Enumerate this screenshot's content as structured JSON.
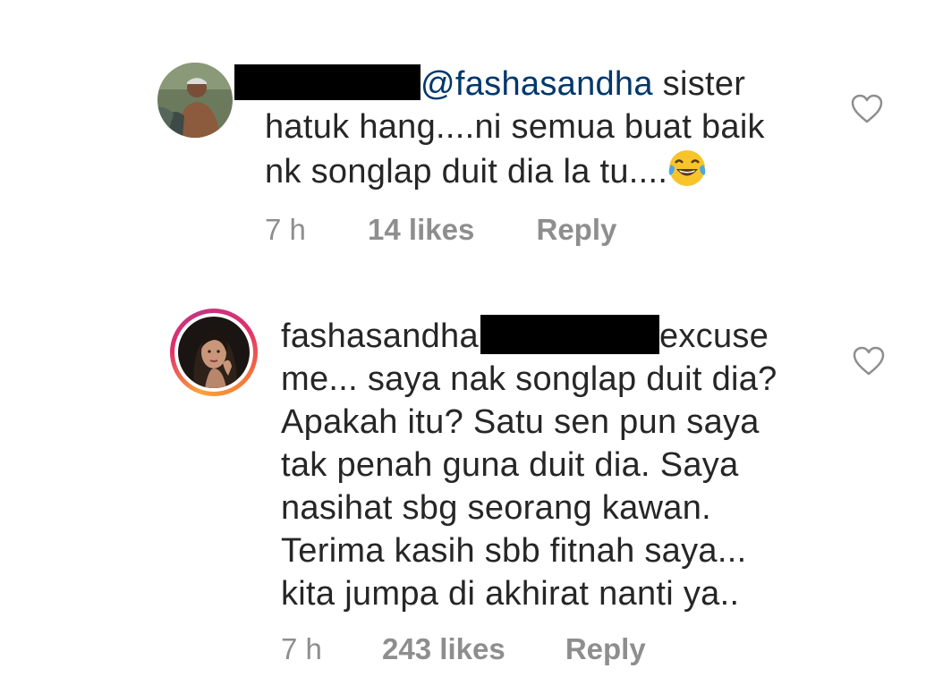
{
  "comments": [
    {
      "mention": "@fashasandha",
      "line1_tail": " sister",
      "line2": "hatuk hang....ni semua buat baik",
      "line3": "nk songlap duit dia la tu....",
      "emoji": "face-with-tears-of-joy",
      "time": "7 h",
      "likes": "14 likes",
      "reply": "Reply"
    },
    {
      "username": "fashasandha",
      "line1_tail": "excuse",
      "lines": [
        "me... saya nak songlap duit dia?",
        "Apakah itu? Satu sen pun saya",
        "tak penah guna duit dia. Saya",
        "nasihat sbg seorang kawan.",
        "Terima kasih sbb fitnah saya...",
        "kita jumpa di akhirat nanti ya.."
      ],
      "time": "7 h",
      "likes": "243 likes",
      "reply": "Reply"
    }
  ],
  "colors": {
    "text": "#262626",
    "mention": "#00376b",
    "meta": "#8e8e8e",
    "redaction": "#000000"
  },
  "icons": [
    "heart-icon",
    "avatar",
    "story-ring"
  ]
}
